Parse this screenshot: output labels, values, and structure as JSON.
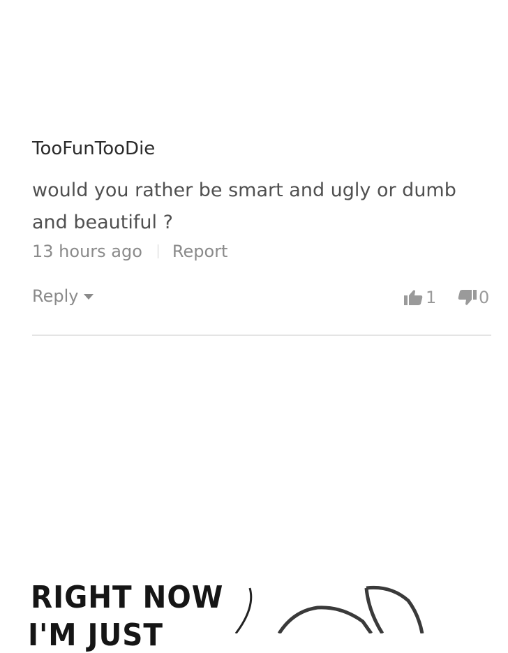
{
  "comment": {
    "username": "TooFunTooDie",
    "text_line1": "would you rather be smart and ugly or dumb",
    "text_line2": "and beautiful ?",
    "timestamp": "13 hours ago",
    "report_label": "Report",
    "reply_label": "Reply",
    "upvotes": "1",
    "downvotes": "0"
  },
  "comic": {
    "line1": "RIGHT NOW",
    "line2": "I'M JUST"
  },
  "icons": [
    "thumbs-up-icon",
    "thumbs-down-icon",
    "chevron-down-icon"
  ],
  "colors": {
    "username": "#2a2a2a",
    "body_text": "#505050",
    "meta_text": "#8a8a8a",
    "divider": "#e4e4e4"
  }
}
